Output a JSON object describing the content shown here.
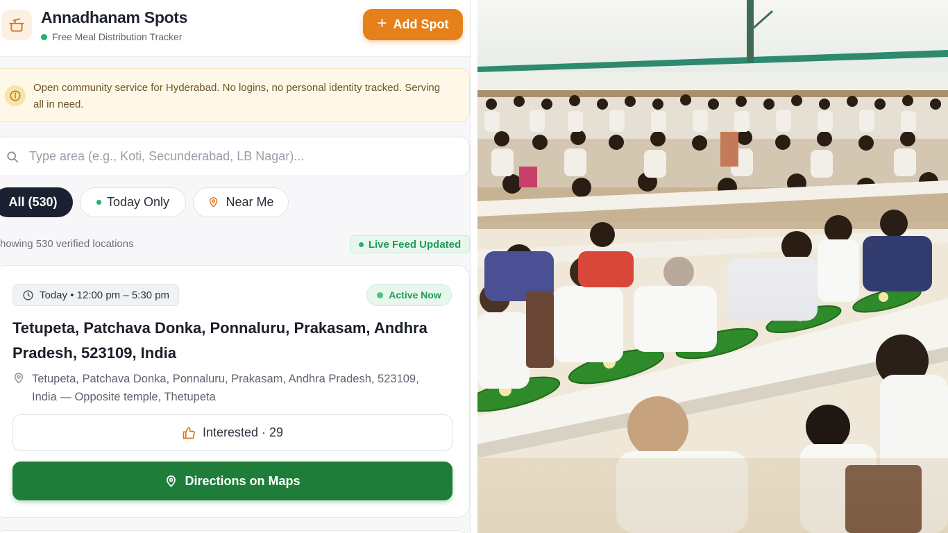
{
  "header": {
    "title": "Annadhanam Spots",
    "subtitle": "Free Meal Distribution Tracker",
    "add_button": "Add Spot",
    "add_icon": "plus-icon"
  },
  "notice": {
    "text": "Open community service for Hyderabad. No logins, no personal identity tracked. Serving all in need.",
    "icon": "info-icon"
  },
  "search": {
    "placeholder": "Type area (e.g., Koti, Secunderabad, LB Nagar)...",
    "value": ""
  },
  "filters": {
    "all": "All (530)",
    "today": "Today Only",
    "near": "Near Me"
  },
  "results": {
    "showing": "howing 530 verified locations",
    "live": "Live Feed Updated"
  },
  "card": {
    "time": "Today • 12:00 pm – 5:30 pm",
    "status": "Active Now",
    "title": "Tetupeta, Patchava Donka, Ponnaluru, Prakasam, Andhra Pradesh, 523109, India",
    "address": "Tetupeta, Patchava Donka, Ponnaluru, Prakasam, Andhra Pradesh, 523109, India — Opposite temple, Thetupeta",
    "interested": "Interested · 29",
    "directions": "Directions on Maps"
  },
  "colors": {
    "accent_orange": "#e5801a",
    "green_primary": "#1f7d3a",
    "status_green": "#23b26d",
    "dark_chip": "#1b2130"
  }
}
